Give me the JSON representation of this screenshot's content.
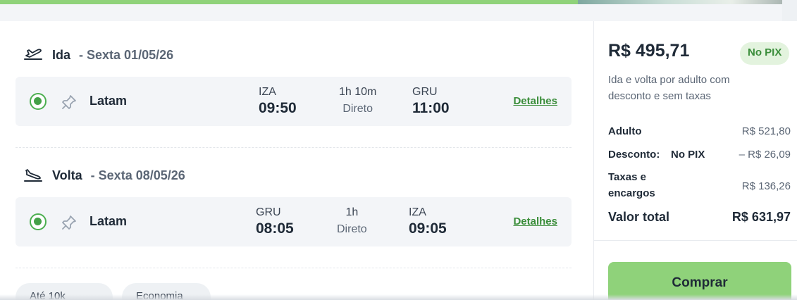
{
  "outbound": {
    "label": "Ida",
    "date": "- Sexta 01/05/26",
    "airline": "Latam",
    "origin_code": "IZA",
    "departure_time": "09:50",
    "duration": "1h 10m",
    "stops": "Direto",
    "destination_code": "GRU",
    "arrival_time": "11:00",
    "details_label": "Detalhes"
  },
  "return": {
    "label": "Volta",
    "date": "- Sexta 08/05/26",
    "airline": "Latam",
    "origin_code": "GRU",
    "departure_time": "08:05",
    "duration": "1h",
    "stops": "Direto",
    "destination_code": "IZA",
    "arrival_time": "09:05",
    "details_label": "Detalhes"
  },
  "filters": {
    "pill_1": "Até 10k",
    "pill_2": "Economia"
  },
  "summary": {
    "price": "R$ 495,71",
    "pix_badge": "No PIX",
    "description": "Ida e volta por adulto com desconto e sem taxas",
    "adult_label": "Adulto",
    "adult_value": "R$ 521,80",
    "discount_label": "Desconto:",
    "discount_method": "No PIX",
    "discount_value": "– R$ 26,09",
    "taxes_label_line1": "Taxas e",
    "taxes_label_line2": "encargos",
    "taxes_value": "R$ 136,26",
    "total_label": "Valor total",
    "total_value": "R$ 631,97",
    "buy_label": "Comprar"
  },
  "colors": {
    "accent_green": "#8fd27a",
    "link_green": "#3a8d3a",
    "card_bg": "#f3f5f8"
  },
  "icons": {
    "outbound": "plane-departure-icon",
    "return": "plane-arrival-icon",
    "pin": "pin-icon",
    "radio": "radio-selected-icon"
  }
}
